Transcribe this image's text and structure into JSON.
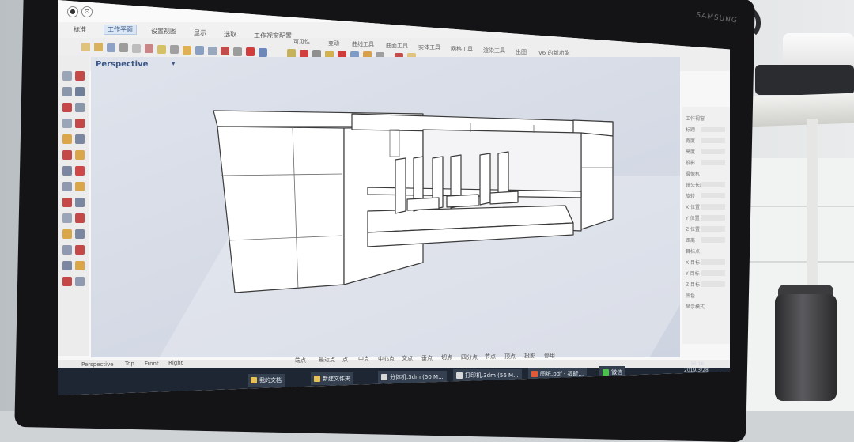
{
  "scene": {
    "monitor_brand": "SAMSUNG"
  },
  "window": {
    "controls": [
      "●",
      "⊙"
    ]
  },
  "menubar": {
    "items": [
      {
        "label": "标准",
        "active": false
      },
      {
        "label": "工作平面",
        "active": true
      },
      {
        "label": "设置视图",
        "active": false
      },
      {
        "label": "显示",
        "active": false
      },
      {
        "label": "选取",
        "active": false
      },
      {
        "label": "工作视窗配置",
        "active": false
      }
    ]
  },
  "toolbar": {
    "labels": [
      "可见性",
      "变动",
      "曲线工具",
      "曲面工具",
      "实体工具",
      "网格工具",
      "渲染工具",
      "出图",
      "V6 的新功能"
    ]
  },
  "viewport": {
    "name": "Perspective",
    "dropdown_glyph": "▾"
  },
  "right_panel": {
    "rows": [
      "工作视窗",
      "标题",
      "宽度",
      "高度",
      "投影",
      "摄像机",
      "镜头长度",
      "旋转",
      "X 位置",
      "Y 位置",
      "Z 位置",
      "距离",
      "目标点",
      "X 目标",
      "Y 目标",
      "Z 目标",
      "底色",
      "显示模式"
    ]
  },
  "statusbar": {
    "tabs": [
      "Perspective",
      "Top",
      "Front",
      "Right",
      "端点",
      "最近点",
      "点",
      "中点",
      "中心点",
      "交点",
      "垂点",
      "切点",
      "四分点",
      "节点",
      "顶点",
      "投影",
      "停用"
    ]
  },
  "taskbar": {
    "items": [
      {
        "label": "我的文档"
      },
      {
        "label": "新建文件夹"
      },
      {
        "label": "分体机.3dm (50 M..."
      },
      {
        "label": "打印机.3dm (56 M..."
      },
      {
        "label": "图纸.pdf - 福昕..."
      },
      {
        "label": "微信"
      }
    ],
    "clock_time": "16:16",
    "clock_date": "2019/3/28"
  },
  "colors": {
    "viewport_bg": "#d3d8e3",
    "model_face": "#ffffff",
    "model_edge": "#3a3a3a",
    "viewport_label": "#3c5888",
    "taskbar_bg": "#1d2632"
  }
}
